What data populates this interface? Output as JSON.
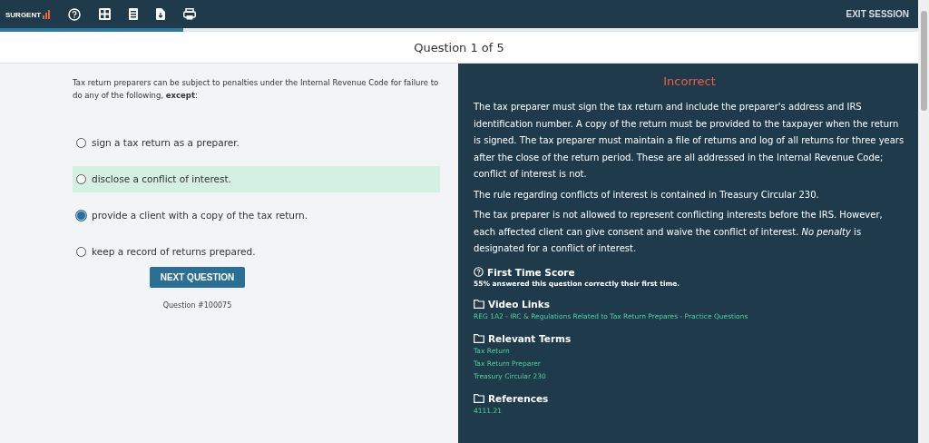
{
  "header": {
    "logo": "SURGENT",
    "exit": "EXIT SESSION",
    "progress": {
      "level": 0.2
    }
  },
  "question_bar": {
    "title": "Question 1 of 5"
  },
  "question": {
    "prompt": "Tax return preparers can be subject to penalties under the Internal Revenue Code for failure to do any of the following, **except**:",
    "options": [
      {
        "label": "sign a tax return as a preparer.",
        "selected": false,
        "correct": false
      },
      {
        "label": "disclose a conflict of interest.",
        "selected": false,
        "correct": true
      },
      {
        "label": "provide a client with a copy of the tax return.",
        "selected": true,
        "correct": false
      },
      {
        "label": "keep a record of returns prepared.",
        "selected": false,
        "correct": false
      }
    ],
    "next_button": "NEXT QUESTION",
    "question_id": "Question #100075"
  },
  "feedback": {
    "result": "Incorrect",
    "paragraphs": [
      "The tax preparer must sign the tax return and include the preparer's address and IRS identification number. A copy of the return must be provided to the taxpayer when the return is signed. The tax preparer must maintain a file of returns and log of all returns for three years after the close of the return period. These are all addressed in the Internal Revenue Code; conflict of interest is not.",
      "The rule regarding conflicts of interest is contained in Treasury Circular 230.",
      "The tax preparer is not allowed to represent conflicting interests before the IRS. However, each affected client can give consent and waive the conflict of interest. *No penalty* is designated for a conflict of interest."
    ],
    "sections": [
      {
        "kind": "score",
        "title": "First Time Score",
        "items": [
          "55% answered this question correctly their first time."
        ]
      },
      {
        "kind": "folder",
        "title": "Video Links",
        "items": [
          "REG 1A2 - IRC & Regulations Related to Tax Return Prepares - Practice Questions"
        ]
      },
      {
        "kind": "folder",
        "title": "Relevant Terms",
        "items": [
          "Tax Return",
          "Tax Return Preparer",
          "Treasury Circular 230"
        ]
      },
      {
        "kind": "folder",
        "title": "References",
        "items": [
          "4111.21"
        ]
      }
    ]
  }
}
